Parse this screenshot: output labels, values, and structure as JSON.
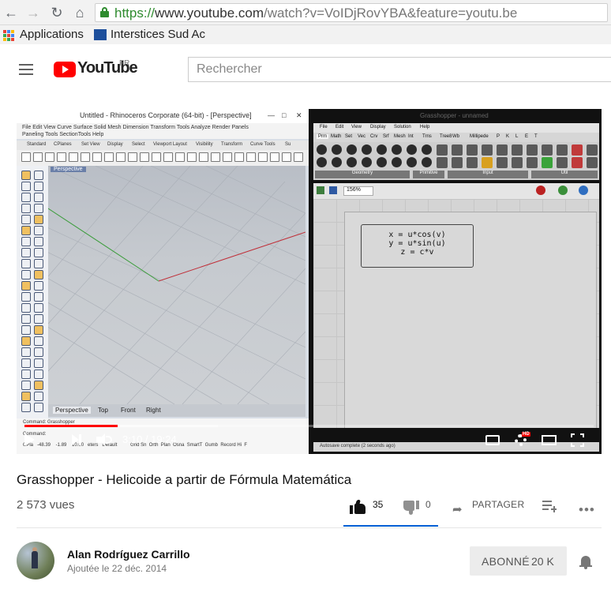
{
  "browser": {
    "url_scheme": "https://",
    "url_host": "www.youtube.com",
    "url_rest": "/watch?v=VoIDjRovYBA&feature=youtu.be",
    "bookmarks": [
      {
        "label": "Applications"
      },
      {
        "label": "Interstices Sud Ac"
      }
    ]
  },
  "youtube": {
    "logo_text": "YouTube",
    "country": "FR",
    "search_placeholder": "Rechercher"
  },
  "video": {
    "rhino": {
      "title": "Untitled - Rhinoceros Corporate (64-bit) - [Perspective]",
      "menu_line1": "File   Edit   View   Curve   Surface   Solid   Mesh   Dimension   Transform   Tools   Analyze   Render   Panels",
      "menu_line2": "Paneling Tools   SectionTools   Help",
      "toolbar_tabs": [
        "Standard",
        "CPlanes",
        "Set View",
        "Display",
        "Select",
        "Viewport Layout",
        "Visibility",
        "Transform",
        "Curve Tools",
        "Su"
      ],
      "viewport_label": "Perspective",
      "view_tabs": [
        "Perspective",
        "Top",
        "Front",
        "Right"
      ],
      "command_line": "Command: Grasshopper",
      "command_prompt": "Command:",
      "status_line": "CPla   -48.39    -1.89    10.00   eters   Default          Grid Sn  Orth  Plan  Osna  SmartT  Gumb  Record Hi  F"
    },
    "grasshopper": {
      "title": "Grasshopper - unnamed",
      "menu": [
        "File",
        "Edit",
        "View",
        "Display",
        "Solution",
        "Help"
      ],
      "tabs": [
        "Prm",
        "Math",
        "Set",
        "Vec",
        "Crv",
        "Srf",
        "Mesh",
        "Int",
        "Trns",
        "Tree8",
        "Wb",
        "Millipede",
        "P",
        "K",
        "L",
        "E",
        "T"
      ],
      "sections": [
        "Geometry",
        "Primitive",
        "Input",
        "Util"
      ],
      "zoom": "156%",
      "expression_lines": [
        "x = u*cos(v)",
        "y = u*sin(u)",
        "z = c*v"
      ],
      "status": "Autosave complete (2 seconds ago)"
    },
    "player": {
      "current_time": "3:10",
      "duration": "19:24",
      "progress_fraction": 0.163,
      "buffered_fraction": 0.34,
      "hd_badge": "HD"
    }
  },
  "info": {
    "title": "Grasshopper - Helicoide a partir de Fórmula Matemática",
    "views": "2 573 vues",
    "likes": "35",
    "dislikes": "0",
    "share_label": "PARTAGER",
    "like_fraction": 1.0
  },
  "channel": {
    "name": "Alan Rodríguez Carrillo",
    "published": "Ajoutée le 22 déc. 2014",
    "subscribe_label": "ABONNÉ",
    "subscribers": "20 K"
  },
  "colors": {
    "accent_red": "#ff0000",
    "like_blue": "#065fd4",
    "secure_green": "#2e8b2e"
  }
}
